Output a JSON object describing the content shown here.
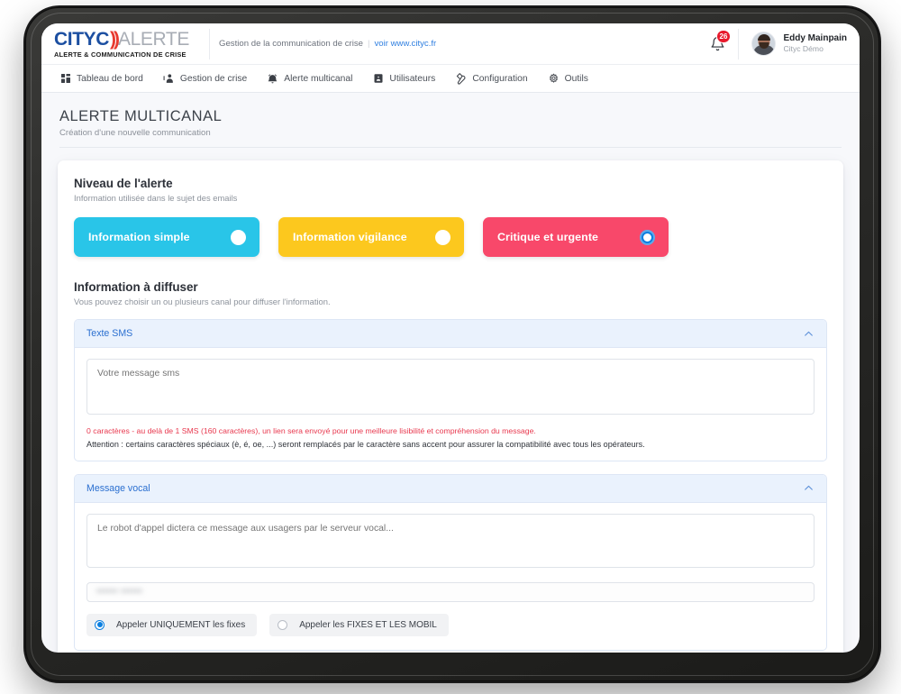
{
  "brand": {
    "logo_cityc": "CITYC",
    "logo_waves": "))",
    "logo_alerte": "ALERTE",
    "logo_tagline_a": "ALERTE & COMMUNICATION DE ",
    "logo_tagline_b": "CRISE",
    "tagline": "Gestion de la communication de crise",
    "separator": "|",
    "site_link": "voir www.cityc.fr"
  },
  "topbar": {
    "notification_count": "26",
    "bell_icon": "bell-icon",
    "user_name": "Eddy Mainpain",
    "user_org": "Cityc Démo"
  },
  "nav": {
    "items": [
      {
        "label": "Tableau de bord",
        "icon": "dashboard-grid-icon"
      },
      {
        "label": "Gestion de crise",
        "icon": "siren-icon"
      },
      {
        "label": "Alerte multicanal",
        "icon": "alarm-bell-icon"
      },
      {
        "label": "Utilisateurs",
        "icon": "id-card-icon"
      },
      {
        "label": "Configuration",
        "icon": "wrench-icon"
      },
      {
        "label": "Outils",
        "icon": "gear-icon"
      }
    ]
  },
  "page": {
    "title": "ALERTE MULTICANAL",
    "subtitle": "Création d'une nouvelle communication"
  },
  "level_section": {
    "title": "Niveau de l'alerte",
    "subtitle": "Information utilisée dans le sujet des emails",
    "options": [
      {
        "label": "Information simple",
        "color": "#29c5e8",
        "selected": false
      },
      {
        "label": "Information vigilance",
        "color": "#fcc81e",
        "selected": false
      },
      {
        "label": "Critique et urgente",
        "color": "#f8486a",
        "selected": true
      }
    ],
    "selected_radio_color": "#0b7fe0"
  },
  "diffuse_section": {
    "title": "Information à diffuser",
    "subtitle": "Vous pouvez choisir un ou plusieurs canal pour diffuser l'information."
  },
  "sms_panel": {
    "title": "Texte SMS",
    "chevron": "chevron-up-icon",
    "placeholder": "Votre message sms",
    "value": "",
    "counter_hint": "0 caractères - au delà de 1 SMS (160 caractères), un lien sera envoyé pour une meilleure lisibilité et compréhension du message.",
    "accent_hint": "Attention : certains caractères spéciaux (è, é, oe, ...) seront remplacés par le caractère sans accent pour assurer la compatibilité avec tous les opérateurs."
  },
  "voice_panel": {
    "title": "Message vocal",
    "chevron": "chevron-up-icon",
    "placeholder": "Le robot d'appel dictera ce message aux usagers par le serveur vocal...",
    "value": "",
    "masked_field_value": "•••••• ••••••",
    "call_options": [
      {
        "label": "Appeler UNIQUEMENT les fixes",
        "selected": true
      },
      {
        "label": "Appeler les FIXES ET LES MOBIL",
        "selected": false
      }
    ]
  },
  "colors": {
    "panel_header_bg": "#eaf2fd",
    "panel_title": "#2a6fd0",
    "warning_red": "#e8394f",
    "badge_red": "#e8192c",
    "link_blue": "#2f7fe0"
  }
}
